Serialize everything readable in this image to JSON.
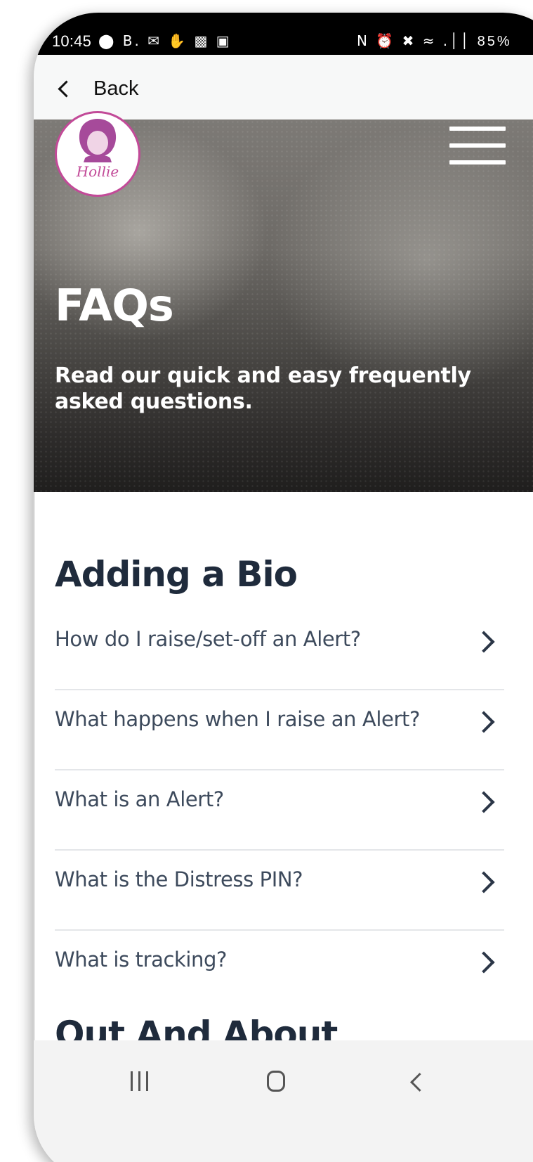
{
  "status_bar": {
    "time": "10:45",
    "left_icons": "⬤ B. ✉ ✋ ▩ ▣",
    "right_icons": "N ⏰ ✖ ≈ .││",
    "battery": "85%"
  },
  "top_nav": {
    "back_label": "Back"
  },
  "hero": {
    "logo_text": "Hollie",
    "title": "FAQs",
    "subtitle": "Read our quick and easy frequently asked questions."
  },
  "sections": [
    {
      "heading": "Adding a Bio",
      "items": [
        {
          "question": "How do I raise/set-off an Alert?"
        },
        {
          "question": "What happens when I raise an Alert?"
        },
        {
          "question": "What is an Alert?"
        },
        {
          "question": "What is the Distress PIN?"
        },
        {
          "question": "What is tracking?"
        }
      ]
    },
    {
      "heading": "Out And About"
    }
  ],
  "colors": {
    "heading": "#1f2b3c",
    "question_text": "#3d4a5c",
    "logo_accent": "#c24a98",
    "divider": "#e4e6e9"
  }
}
